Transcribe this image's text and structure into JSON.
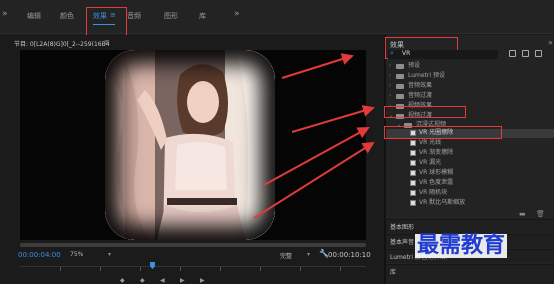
{
  "menu": {
    "tabs": [
      "编辑",
      "颜色",
      "效果",
      "音频",
      "图形",
      "库"
    ],
    "active_tab": "效果",
    "menu_glyph": "≡",
    "overflow_glyph": "»"
  },
  "monitor": {
    "title": "节目: 0[L2A(8)G]0[_2--259(16B4",
    "menu_glyph": "≡",
    "timecode_current": "00:00:04:00",
    "zoom": "75%",
    "quality": "完整",
    "timecode_total": "00:00:10:10"
  },
  "effects": {
    "tab_label": "效果",
    "search_value": "VR",
    "tree": [
      {
        "label": "预设",
        "type": "folder"
      },
      {
        "label": "Lumetri 预设",
        "type": "folder"
      },
      {
        "label": "音频效果",
        "type": "folder"
      },
      {
        "label": "音频过渡",
        "type": "folder"
      },
      {
        "label": "视频效果",
        "type": "folder"
      },
      {
        "label": "视频过渡",
        "type": "folder",
        "expanded": true
      },
      {
        "label": "沉浸式视频",
        "type": "folder",
        "expanded": true
      },
      {
        "label": "VR 光圈擦除",
        "type": "effect",
        "selected": true
      },
      {
        "label": "VR 光线",
        "type": "effect"
      },
      {
        "label": "VR 渐变擦除",
        "type": "effect"
      },
      {
        "label": "VR 漏光",
        "type": "effect"
      },
      {
        "label": "VR 球形模糊",
        "type": "effect"
      },
      {
        "label": "VR 色度泄露",
        "type": "effect"
      },
      {
        "label": "VR 随机块",
        "type": "effect"
      },
      {
        "label": "VR 默比乌斯缩放",
        "type": "effect"
      }
    ],
    "sections": [
      {
        "label": "基本图形"
      },
      {
        "label": "基本声音"
      },
      {
        "label": "Lumetri 颜色",
        "sub": "(无剪辑)"
      },
      {
        "label": "库"
      }
    ]
  },
  "watermark": "最需教育",
  "colors": {
    "accent": "#3d8fe6",
    "annotation": "#e23a3a",
    "watermark": "#1f3bd0"
  }
}
